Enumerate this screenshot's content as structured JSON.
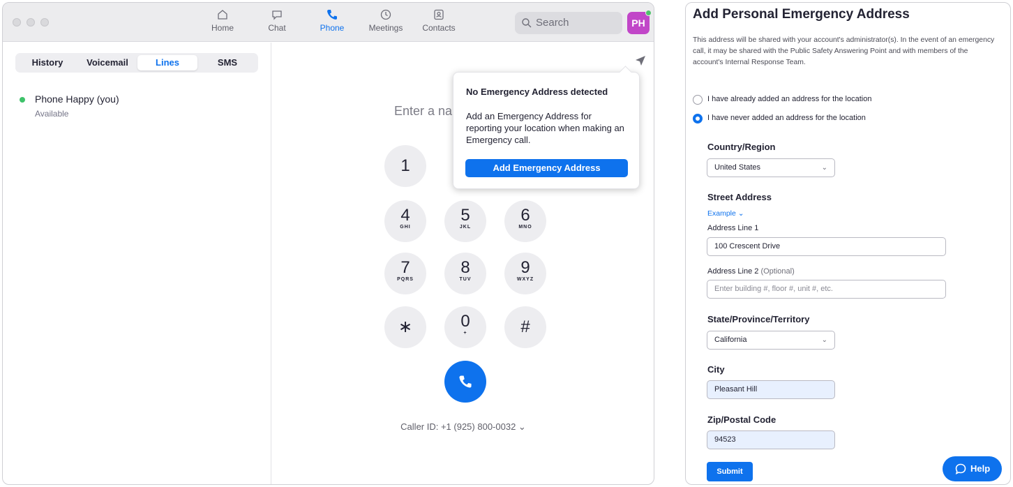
{
  "nav": {
    "tabs": [
      {
        "label": "Home",
        "icon": "home-icon"
      },
      {
        "label": "Chat",
        "icon": "chat-icon"
      },
      {
        "label": "Phone",
        "icon": "phone-icon"
      },
      {
        "label": "Meetings",
        "icon": "clock-icon"
      },
      {
        "label": "Contacts",
        "icon": "contacts-icon"
      }
    ],
    "active_tab": "Phone",
    "search_placeholder": "Search",
    "avatar_initials": "PH"
  },
  "sidebar": {
    "segments": [
      "History",
      "Voicemail",
      "Lines",
      "SMS"
    ],
    "active_segment": "Lines",
    "line": {
      "name": "Phone Happy (you)",
      "status": "Available"
    }
  },
  "dialer": {
    "input_placeholder": "Enter a nam",
    "keys": [
      {
        "digit": "1",
        "letters": ""
      },
      {
        "digit": "4",
        "letters": "GHI"
      },
      {
        "digit": "5",
        "letters": "JKL"
      },
      {
        "digit": "6",
        "letters": "MNO"
      },
      {
        "digit": "7",
        "letters": "PQRS"
      },
      {
        "digit": "8",
        "letters": "TUV"
      },
      {
        "digit": "9",
        "letters": "WXYZ"
      },
      {
        "digit": "∗",
        "letters": ""
      },
      {
        "digit": "0",
        "letters": "+"
      },
      {
        "digit": "#",
        "letters": ""
      }
    ],
    "caller_id": "Caller ID: +1 (925) 800-0032 ⌄"
  },
  "popover": {
    "title": "No Emergency Address detected",
    "body": "Add an Emergency Address for reporting your location when making an Emergency call.",
    "button": "Add Emergency Address"
  },
  "form": {
    "title": "Add Personal Emergency Address",
    "description": "This address will be shared with your account's administrator(s). In the event of an emergency call, it may be shared with the Public Safety Answering Point and with members of the account's Internal Response Team.",
    "radio_already": "I have already added an address for the location",
    "radio_never": "I have never added an address for the location",
    "selected_radio": "never",
    "country_label": "Country/Region",
    "country_value": "United States",
    "street_label": "Street Address",
    "example_link": "Example ⌄",
    "line1_label": "Address Line 1",
    "line1_value": "100 Crescent Drive",
    "line2_label": "Address Line 2",
    "line2_optional": "(Optional)",
    "line2_placeholder": "Enter building #, floor #, unit #, etc.",
    "state_label": "State/Province/Territory",
    "state_value": "California",
    "city_label": "City",
    "city_value": "Pleasant Hill",
    "zip_label": "Zip/Postal Code",
    "zip_value": "94523",
    "submit": "Submit",
    "help": "Help"
  },
  "colors": {
    "accent": "#0e72ed",
    "avatar": "#c146c8",
    "online": "#3ec26a"
  }
}
